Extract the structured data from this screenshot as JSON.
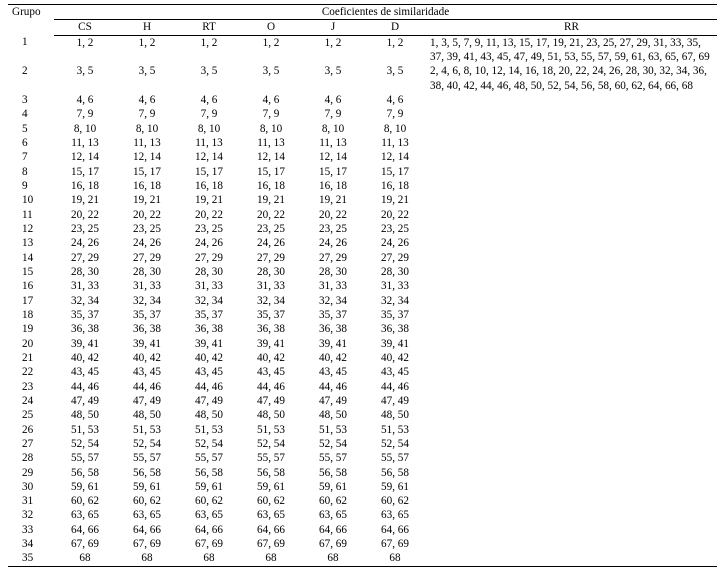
{
  "header": {
    "grupo": "Grupo",
    "spanner": "Coeficientes de similaridade",
    "cols": [
      "CS",
      "H",
      "RT",
      "O",
      "J",
      "D",
      "RR"
    ]
  },
  "rows": [
    {
      "g": "1",
      "v": [
        "1, 2",
        "1, 2",
        "1, 2",
        "1, 2",
        "1, 2",
        "1, 2"
      ],
      "rr": "1, 3, 5, 7, 9, 11, 13, 15, 17, 19, 21, 23, 25, 27, 29, 31, 33, 35, 37, 39, 41, 43, 45, 47, 49, 51, 53, 55, 57, 59, 61, 63, 65, 67, 69"
    },
    {
      "g": "2",
      "v": [
        "3, 5",
        "3, 5",
        "3, 5",
        "3, 5",
        "3, 5",
        "3, 5"
      ],
      "rr": "2, 4, 6, 8, 10, 12, 14, 16, 18, 20, 22, 24, 26, 28, 30, 32, 34, 36, 38, 40, 42, 44, 46, 48, 50, 52, 54, 56, 58, 60, 62, 64, 66, 68"
    },
    {
      "g": "3",
      "v": [
        "4, 6",
        "4, 6",
        "4, 6",
        "4, 6",
        "4, 6",
        "4, 6"
      ],
      "rr": ""
    },
    {
      "g": "4",
      "v": [
        "7, 9",
        "7, 9",
        "7, 9",
        "7, 9",
        "7, 9",
        "7, 9"
      ],
      "rr": ""
    },
    {
      "g": "5",
      "v": [
        "8, 10",
        "8, 10",
        "8, 10",
        "8, 10",
        "8, 10",
        "8, 10"
      ],
      "rr": ""
    },
    {
      "g": "6",
      "v": [
        "11, 13",
        "11, 13",
        "11, 13",
        "11, 13",
        "11, 13",
        "11, 13"
      ],
      "rr": ""
    },
    {
      "g": "7",
      "v": [
        "12, 14",
        "12, 14",
        "12, 14",
        "12, 14",
        "12, 14",
        "12, 14"
      ],
      "rr": ""
    },
    {
      "g": "8",
      "v": [
        "15, 17",
        "15, 17",
        "15, 17",
        "15, 17",
        "15, 17",
        "15, 17"
      ],
      "rr": ""
    },
    {
      "g": "9",
      "v": [
        "16, 18",
        "16, 18",
        "16, 18",
        "16, 18",
        "16, 18",
        "16, 18"
      ],
      "rr": ""
    },
    {
      "g": "10",
      "v": [
        "19, 21",
        "19, 21",
        "19, 21",
        "19, 21",
        "19, 21",
        "19, 21"
      ],
      "rr": ""
    },
    {
      "g": "11",
      "v": [
        "20, 22",
        "20, 22",
        "20, 22",
        "20, 22",
        "20, 22",
        "20, 22"
      ],
      "rr": ""
    },
    {
      "g": "12",
      "v": [
        "23, 25",
        "23, 25",
        "23, 25",
        "23, 25",
        "23, 25",
        "23, 25"
      ],
      "rr": ""
    },
    {
      "g": "13",
      "v": [
        "24, 26",
        "24, 26",
        "24, 26",
        "24, 26",
        "24, 26",
        "24, 26"
      ],
      "rr": ""
    },
    {
      "g": "14",
      "v": [
        "27, 29",
        "27, 29",
        "27, 29",
        "27, 29",
        "27, 29",
        "27, 29"
      ],
      "rr": ""
    },
    {
      "g": "15",
      "v": [
        "28, 30",
        "28, 30",
        "28, 30",
        "28, 30",
        "28, 30",
        "28, 30"
      ],
      "rr": ""
    },
    {
      "g": "16",
      "v": [
        "31, 33",
        "31, 33",
        "31, 33",
        "31, 33",
        "31, 33",
        "31, 33"
      ],
      "rr": ""
    },
    {
      "g": "17",
      "v": [
        "32, 34",
        "32, 34",
        "32, 34",
        "32, 34",
        "32, 34",
        "32, 34"
      ],
      "rr": ""
    },
    {
      "g": "18",
      "v": [
        "35, 37",
        "35, 37",
        "35, 37",
        "35, 37",
        "35, 37",
        "35, 37"
      ],
      "rr": ""
    },
    {
      "g": "19",
      "v": [
        "36, 38",
        "36, 38",
        "36, 38",
        "36, 38",
        "36, 38",
        "36, 38"
      ],
      "rr": ""
    },
    {
      "g": "20",
      "v": [
        "39, 41",
        "39, 41",
        "39, 41",
        "39, 41",
        "39, 41",
        "39, 41"
      ],
      "rr": ""
    },
    {
      "g": "21",
      "v": [
        "40, 42",
        "40, 42",
        "40, 42",
        "40, 42",
        "40, 42",
        "40, 42"
      ],
      "rr": ""
    },
    {
      "g": "22",
      "v": [
        "43, 45",
        "43, 45",
        "43, 45",
        "43, 45",
        "43, 45",
        "43, 45"
      ],
      "rr": ""
    },
    {
      "g": "23",
      "v": [
        "44, 46",
        "44, 46",
        "44, 46",
        "44, 46",
        "44, 46",
        "44, 46"
      ],
      "rr": ""
    },
    {
      "g": "24",
      "v": [
        "47, 49",
        "47, 49",
        "47, 49",
        "47, 49",
        "47, 49",
        "47, 49"
      ],
      "rr": ""
    },
    {
      "g": "25",
      "v": [
        "48, 50",
        "48, 50",
        "48, 50",
        "48, 50",
        "48, 50",
        "48, 50"
      ],
      "rr": ""
    },
    {
      "g": "26",
      "v": [
        "51, 53",
        "51, 53",
        "51, 53",
        "51, 53",
        "51, 53",
        "51, 53"
      ],
      "rr": ""
    },
    {
      "g": "27",
      "v": [
        "52, 54",
        "52, 54",
        "52, 54",
        "52, 54",
        "52, 54",
        "52, 54"
      ],
      "rr": ""
    },
    {
      "g": "28",
      "v": [
        "55, 57",
        "55, 57",
        "55, 57",
        "55, 57",
        "55, 57",
        "55, 57"
      ],
      "rr": ""
    },
    {
      "g": "29",
      "v": [
        "56, 58",
        "56, 58",
        "56, 58",
        "56, 58",
        "56, 58",
        "56, 58"
      ],
      "rr": ""
    },
    {
      "g": "30",
      "v": [
        "59, 61",
        "59, 61",
        "59, 61",
        "59, 61",
        "59, 61",
        "59, 61"
      ],
      "rr": ""
    },
    {
      "g": "31",
      "v": [
        "60, 62",
        "60, 62",
        "60, 62",
        "60, 62",
        "60, 62",
        "60, 62"
      ],
      "rr": ""
    },
    {
      "g": "32",
      "v": [
        "63, 65",
        "63, 65",
        "63, 65",
        "63, 65",
        "63, 65",
        "63, 65"
      ],
      "rr": ""
    },
    {
      "g": "33",
      "v": [
        "64, 66",
        "64, 66",
        "64, 66",
        "64, 66",
        "64, 66",
        "64, 66"
      ],
      "rr": ""
    },
    {
      "g": "34",
      "v": [
        "67, 69",
        "67, 69",
        "67, 69",
        "67, 69",
        "67, 69",
        "67, 69"
      ],
      "rr": ""
    },
    {
      "g": "35",
      "v": [
        "68",
        "68",
        "68",
        "68",
        "68",
        "68"
      ],
      "rr": ""
    }
  ]
}
